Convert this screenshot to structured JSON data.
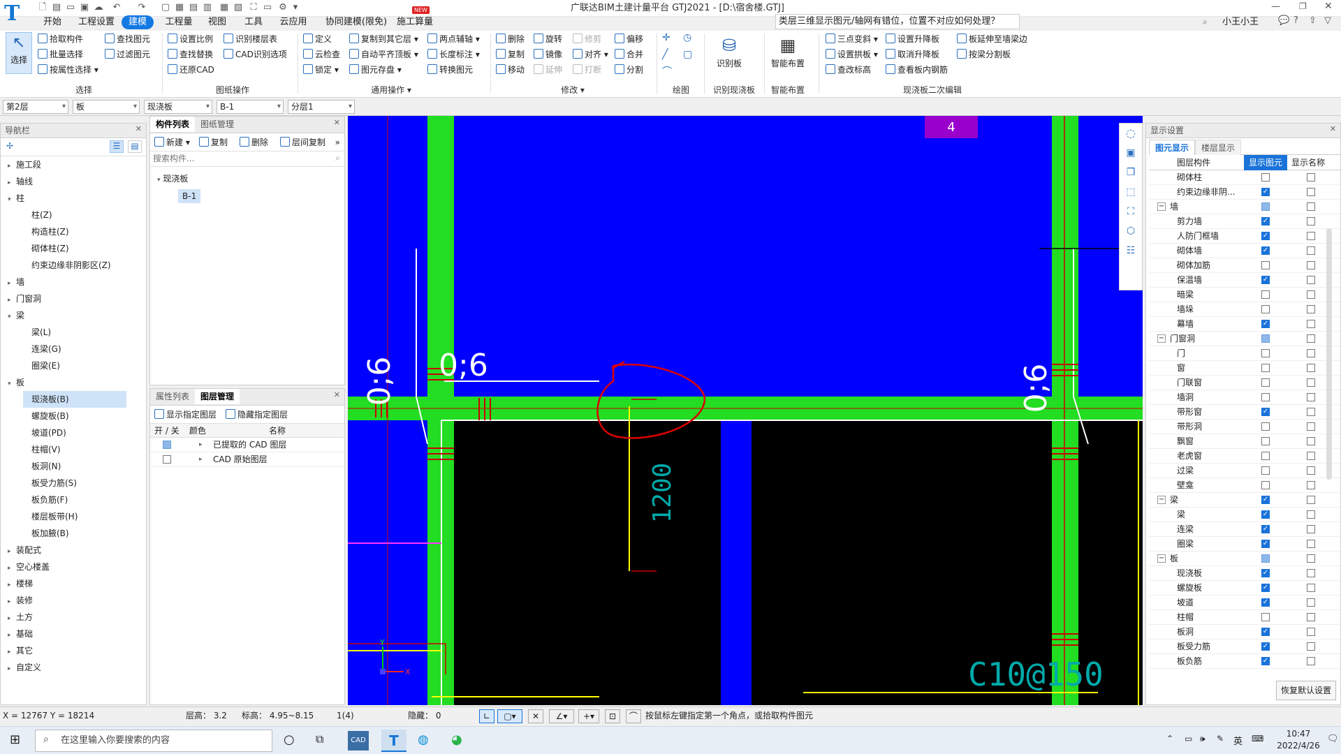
{
  "app": {
    "title": "广联达BIM土建计量平台 GTJ2021 - [D:\\宿舍楼.GTJ]",
    "menu_tabs": [
      "开始",
      "工程设置",
      "建模",
      "工程量",
      "视图",
      "工具",
      "云应用",
      "协同建模(限免)",
      "施工算量"
    ],
    "active_tab": "建模",
    "new_badge": "NEW",
    "help_search": "类层三维显示图元/轴网有错位，位置不对应如何处理？",
    "user": "小王小王"
  },
  "ribbon": {
    "select_big": "选择",
    "select_items": [
      "拾取构件",
      "批量选择",
      "按属性选择",
      "查找图元",
      "过滤图元"
    ],
    "select_label": "选择",
    "drawing_items": [
      "设置比例",
      "识别楼层表",
      "查找替换",
      "CAD识别选项",
      "还原CAD"
    ],
    "drawing_label": "图纸操作",
    "common_items": [
      "定义",
      "复制到其它层",
      "两点辅轴",
      "云检查",
      "自动平齐顶板",
      "长度标注",
      "锁定",
      "图元存盘",
      "转换图元"
    ],
    "common_label": "通用操作",
    "modify_items": [
      "删除",
      "旋转",
      "修剪",
      "偏移",
      "复制",
      "镜像",
      "对齐",
      "合并",
      "移动",
      "延伸",
      "打断",
      "分割"
    ],
    "modify_label": "修改",
    "draw_label": "绘图",
    "identify_big": "识别板",
    "identify_label": "识别现浇板",
    "smart_big": "智能布置",
    "smart_label": "智能布置",
    "edit_items": [
      "三点变斜",
      "设置升降板",
      "板延伸至墙梁边",
      "设置拱板",
      "取消升降板",
      "按梁分割板",
      "查改标高",
      "查看板内钢筋"
    ],
    "edit_label": "现浇板二次编辑"
  },
  "filters": [
    "第2层",
    "板",
    "现浇板",
    "B-1",
    "分层1"
  ],
  "nav": {
    "title": "导航栏",
    "items": [
      {
        "label": "施工段",
        "level": 0,
        "arrow": "▸"
      },
      {
        "label": "轴线",
        "level": 0,
        "arrow": "▸"
      },
      {
        "label": "柱",
        "level": 0,
        "arrow": "▾"
      },
      {
        "label": "柱(Z)",
        "level": 1
      },
      {
        "label": "构造柱(Z)",
        "level": 1
      },
      {
        "label": "砌体柱(Z)",
        "level": 1
      },
      {
        "label": "约束边缘非阴影区(Z)",
        "level": 1
      },
      {
        "label": "墙",
        "level": 0,
        "arrow": "▸"
      },
      {
        "label": "门窗洞",
        "level": 0,
        "arrow": "▸"
      },
      {
        "label": "梁",
        "level": 0,
        "arrow": "▾"
      },
      {
        "label": "梁(L)",
        "level": 1
      },
      {
        "label": "连梁(G)",
        "level": 1
      },
      {
        "label": "圈梁(E)",
        "level": 1
      },
      {
        "label": "板",
        "level": 0,
        "arrow": "▾"
      },
      {
        "label": "现浇板(B)",
        "level": 1,
        "selected": true
      },
      {
        "label": "螺旋板(B)",
        "level": 1
      },
      {
        "label": "坡道(PD)",
        "level": 1
      },
      {
        "label": "柱帽(V)",
        "level": 1
      },
      {
        "label": "板洞(N)",
        "level": 1
      },
      {
        "label": "板受力筋(S)",
        "level": 1
      },
      {
        "label": "板负筋(F)",
        "level": 1
      },
      {
        "label": "楼层板带(H)",
        "level": 1
      },
      {
        "label": "板加腋(B)",
        "level": 1
      },
      {
        "label": "装配式",
        "level": 0,
        "arrow": "▸"
      },
      {
        "label": "空心楼盖",
        "level": 0,
        "arrow": "▸"
      },
      {
        "label": "楼梯",
        "level": 0,
        "arrow": "▸"
      },
      {
        "label": "装修",
        "level": 0,
        "arrow": "▸"
      },
      {
        "label": "土方",
        "level": 0,
        "arrow": "▸"
      },
      {
        "label": "基础",
        "level": 0,
        "arrow": "▸"
      },
      {
        "label": "其它",
        "level": 0,
        "arrow": "▸"
      },
      {
        "label": "自定义",
        "level": 0,
        "arrow": "▸"
      }
    ]
  },
  "component": {
    "tabs": [
      "构件列表",
      "图纸管理"
    ],
    "toolbar": [
      "新建",
      "复制",
      "删除",
      "层间复制"
    ],
    "search_placeholder": "搜索构件...",
    "tree_root": "现浇板",
    "tree_child": "B-1"
  },
  "layers": {
    "tabs": [
      "属性列表",
      "图层管理"
    ],
    "toolbar": [
      "显示指定图层",
      "隐藏指定图层"
    ],
    "headers": [
      "开 / 关",
      "颜色",
      "名称"
    ],
    "rows": [
      "已提取的 CAD 图层",
      "CAD 原始图层"
    ]
  },
  "canvas": {
    "axis_label": "4",
    "dim1": "0;6",
    "dim2": "0;6",
    "dim3": "0;6",
    "dim_vertical": "1200",
    "rebar_text": "C10@150",
    "y_label": "Y",
    "x_label": "X"
  },
  "display": {
    "title": "显示设置",
    "tabs": [
      "图元显示",
      "楼层显示"
    ],
    "headers": [
      "图层构件",
      "显示图元",
      "显示名称"
    ],
    "rows": [
      {
        "label": "砌体柱",
        "indent": 1,
        "show": false,
        "name": false
      },
      {
        "label": "约束边缘非阴...",
        "indent": 1,
        "show": true,
        "name": false
      },
      {
        "label": "墙",
        "indent": 0,
        "group": true,
        "show": "part",
        "name": false
      },
      {
        "label": "剪力墙",
        "indent": 1,
        "show": true,
        "name": false
      },
      {
        "label": "人防门框墙",
        "indent": 1,
        "show": true,
        "name": false
      },
      {
        "label": "砌体墙",
        "indent": 1,
        "show": true,
        "name": false
      },
      {
        "label": "砌体加筋",
        "indent": 1,
        "show": false,
        "name": false
      },
      {
        "label": "保温墙",
        "indent": 1,
        "show": true,
        "name": false
      },
      {
        "label": "暗梁",
        "indent": 1,
        "show": false,
        "name": false
      },
      {
        "label": "墙垛",
        "indent": 1,
        "show": false,
        "name": false
      },
      {
        "label": "幕墙",
        "indent": 1,
        "show": true,
        "name": false
      },
      {
        "label": "门窗洞",
        "indent": 0,
        "group": true,
        "show": "part",
        "name": false
      },
      {
        "label": "门",
        "indent": 1,
        "show": false,
        "name": false
      },
      {
        "label": "窗",
        "indent": 1,
        "show": false,
        "name": false
      },
      {
        "label": "门联窗",
        "indent": 1,
        "show": false,
        "name": false
      },
      {
        "label": "墙洞",
        "indent": 1,
        "show": false,
        "name": false
      },
      {
        "label": "带形窗",
        "indent": 1,
        "show": true,
        "name": false
      },
      {
        "label": "带形洞",
        "indent": 1,
        "show": false,
        "name": false
      },
      {
        "label": "飘窗",
        "indent": 1,
        "show": false,
        "name": false
      },
      {
        "label": "老虎窗",
        "indent": 1,
        "show": false,
        "name": false
      },
      {
        "label": "过梁",
        "indent": 1,
        "show": false,
        "name": false
      },
      {
        "label": "壁龛",
        "indent": 1,
        "show": false,
        "name": false
      },
      {
        "label": "梁",
        "indent": 0,
        "group": true,
        "show": true,
        "name": false
      },
      {
        "label": "梁",
        "indent": 1,
        "show": true,
        "name": false
      },
      {
        "label": "连梁",
        "indent": 1,
        "show": true,
        "name": false
      },
      {
        "label": "圈梁",
        "indent": 1,
        "show": true,
        "name": false
      },
      {
        "label": "板",
        "indent": 0,
        "group": true,
        "show": "part",
        "name": false
      },
      {
        "label": "现浇板",
        "indent": 1,
        "show": true,
        "name": false
      },
      {
        "label": "螺旋板",
        "indent": 1,
        "show": true,
        "name": false
      },
      {
        "label": "坡道",
        "indent": 1,
        "show": true,
        "name": false
      },
      {
        "label": "柱帽",
        "indent": 1,
        "show": false,
        "name": false
      },
      {
        "label": "板洞",
        "indent": 1,
        "show": true,
        "name": false
      },
      {
        "label": "板受力筋",
        "indent": 1,
        "show": true,
        "name": false
      },
      {
        "label": "板负筋",
        "indent": 1,
        "show": true,
        "name": false
      }
    ],
    "restore_button": "恢复默认设置"
  },
  "status": {
    "coords": "X = 12767 Y = 18214",
    "floor_height": "层高：  3.2",
    "elevation": "标高：  4.95~8.15",
    "count": "1(4)",
    "hidden": "隐藏：  0",
    "hint": "按鼠标左键指定第一个角点，或拾取构件图元"
  },
  "taskbar": {
    "search_placeholder": "在这里输入你要搜索的内容",
    "ime": "英",
    "time": "10:47",
    "date": "2022/4/26"
  },
  "colors": {
    "accent": "#1479e2",
    "canvas_blue": "#0000ff",
    "beam_green": "#22dd22",
    "slab_black": "#000000"
  }
}
